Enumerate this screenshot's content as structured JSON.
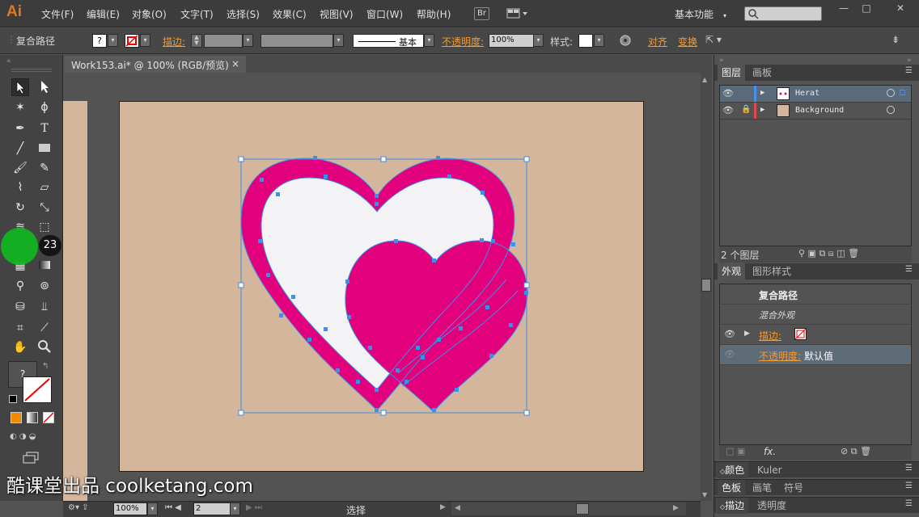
{
  "app": {
    "logo": "Ai"
  },
  "menu": [
    "文件(F)",
    "编辑(E)",
    "对象(O)",
    "文字(T)",
    "选择(S)",
    "效果(C)",
    "视图(V)",
    "窗口(W)",
    "帮助(H)"
  ],
  "bridge": "Br",
  "workspace": "基本功能",
  "controlbar": {
    "object_type": "复合路径",
    "stroke_label": "描边:",
    "stroke_style": "基本",
    "opacity_label": "不透明度:",
    "opacity_value": "100%",
    "style_label": "样式:",
    "align_label": "对齐",
    "transform_label": "变换",
    "fill_question": "?"
  },
  "document": {
    "tab_title": "Work153.ai* @ 100% (RGB/预览)",
    "close": "×"
  },
  "toolbar": {
    "swatch_question": "?",
    "cursor_badge": "23"
  },
  "status": {
    "zoom": "100%",
    "page": "2",
    "tool": "选择"
  },
  "layers_panel": {
    "tabs": [
      "图层",
      "画板"
    ],
    "layers": [
      {
        "name": "Herat",
        "color": "#4a8ef0"
      },
      {
        "name": "Background",
        "color": "#e0474c"
      }
    ],
    "count": "2 个图层"
  },
  "appearance_panel": {
    "tabs": [
      "外观",
      "图形样式"
    ],
    "title": "复合路径",
    "mixed": "混合外观",
    "stroke_label": "描边:",
    "opacity_label": "不透明度:",
    "opacity_value": "默认值",
    "fx": "fx."
  },
  "collapsed_panels": [
    {
      "tabs": [
        "颜色",
        "Kuler"
      ]
    },
    {
      "tabs": [
        "色板",
        "画笔",
        "符号"
      ]
    },
    {
      "tabs": [
        "描边",
        "透明度"
      ]
    }
  ],
  "watermark": "酷课堂出品 coolketang.com",
  "colors": {
    "accent": "#f39a33",
    "heart_magenta": "#e2007c",
    "heart_white": "#f3f3f5",
    "artboard": "#d4b69c",
    "selection": "#3f8fe6"
  }
}
